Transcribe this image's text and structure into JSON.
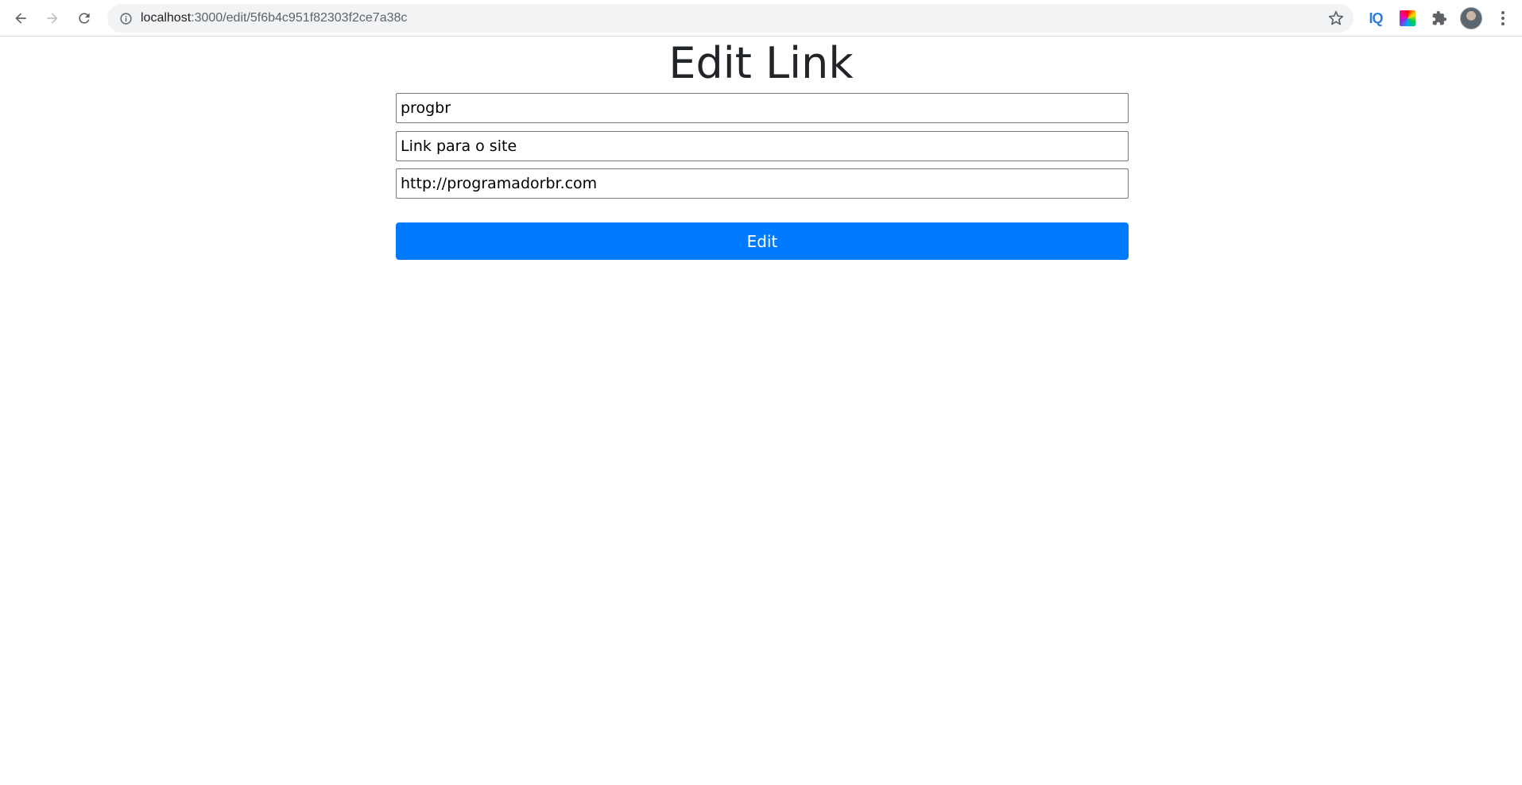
{
  "browser": {
    "url_host": "localhost",
    "url_path": ":3000/edit/5f6b4c951f82303f2ce7a38c",
    "extensions": [
      "iq-extension-icon",
      "color-picker-extension-icon",
      "puzzle-icon"
    ],
    "accent": "#1a73e8"
  },
  "page": {
    "title": "Edit Link",
    "fields": {
      "title_value": "progbr",
      "description_value": "Link para o site",
      "url_value": "http://programadorbr.com"
    },
    "submit_label": "Edit",
    "button_color": "#007bff"
  },
  "icons": {
    "iq_label": "IQ"
  }
}
